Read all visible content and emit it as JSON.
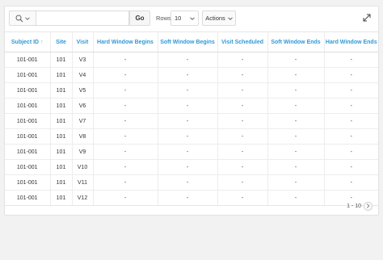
{
  "toolbar": {
    "search_placeholder": "",
    "go_label": "Go",
    "rows_label": "Rows",
    "rows_value": "10",
    "actions_label": "Actions"
  },
  "table": {
    "columns": [
      "Subject ID",
      "Site",
      "Visit",
      "Hard Window Begins",
      "Soft Window Begins",
      "Visit Scheduled",
      "Soft Window Ends",
      "Hard Window Ends"
    ],
    "rows": [
      [
        "101-001",
        "101",
        "V3",
        "-",
        "-",
        "-",
        "-",
        "-"
      ],
      [
        "101-001",
        "101",
        "V4",
        "-",
        "-",
        "-",
        "-",
        "-"
      ],
      [
        "101-001",
        "101",
        "V5",
        "-",
        "-",
        "-",
        "-",
        "-"
      ],
      [
        "101-001",
        "101",
        "V6",
        "-",
        "-",
        "-",
        "-",
        "-"
      ],
      [
        "101-001",
        "101",
        "V7",
        "-",
        "-",
        "-",
        "-",
        "-"
      ],
      [
        "101-001",
        "101",
        "V8",
        "-",
        "-",
        "-",
        "-",
        "-"
      ],
      [
        "101-001",
        "101",
        "V9",
        "-",
        "-",
        "-",
        "-",
        "-"
      ],
      [
        "101-001",
        "101",
        "V10",
        "-",
        "-",
        "-",
        "-",
        "-"
      ],
      [
        "101-001",
        "101",
        "V11",
        "-",
        "-",
        "-",
        "-",
        "-"
      ],
      [
        "101-001",
        "101",
        "V12",
        "-",
        "-",
        "-",
        "-",
        "-"
      ]
    ],
    "sort_icon": "sort-ascending-icon"
  },
  "pagination": {
    "range": "1 - 10",
    "next_icon": "chevron-right-icon"
  },
  "colors": {
    "header_text": "#2f9ad6",
    "background": "#f2f2f2"
  }
}
